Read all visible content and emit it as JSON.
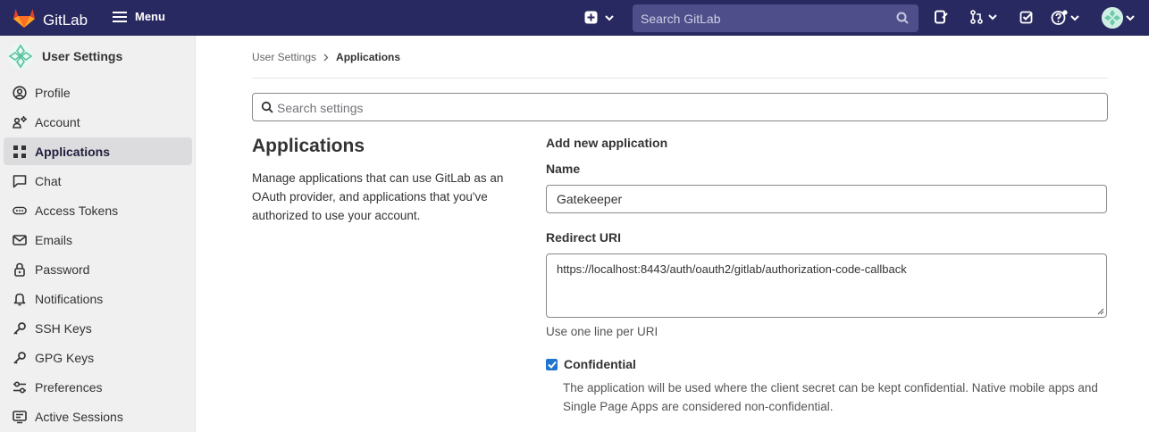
{
  "navbar": {
    "brand": "GitLab",
    "menu_label": "Menu",
    "search_placeholder": "Search GitLab",
    "icons": [
      "plus-square-icon",
      "chevron-down-icon",
      "search-icon",
      "issues-icon",
      "merge-request-icon",
      "todo-icon",
      "help-icon",
      "avatar"
    ]
  },
  "sidebar": {
    "context_title": "User Settings",
    "items": [
      {
        "label": "Profile",
        "icon": "profile-icon",
        "active": false
      },
      {
        "label": "Account",
        "icon": "account-icon",
        "active": false
      },
      {
        "label": "Applications",
        "icon": "applications-icon",
        "active": true
      },
      {
        "label": "Chat",
        "icon": "comment-icon",
        "active": false
      },
      {
        "label": "Access Tokens",
        "icon": "token-icon",
        "active": false
      },
      {
        "label": "Emails",
        "icon": "mail-icon",
        "active": false
      },
      {
        "label": "Password",
        "icon": "lock-icon",
        "active": false
      },
      {
        "label": "Notifications",
        "icon": "notifications-icon",
        "active": false
      },
      {
        "label": "SSH Keys",
        "icon": "key-icon",
        "active": false
      },
      {
        "label": "GPG Keys",
        "icon": "key-icon",
        "active": false
      },
      {
        "label": "Preferences",
        "icon": "preferences-icon",
        "active": false
      },
      {
        "label": "Active Sessions",
        "icon": "monitor-lines-icon",
        "active": false
      }
    ]
  },
  "breadcrumb": {
    "parent": "User Settings",
    "current": "Applications"
  },
  "settings_search": {
    "placeholder": "Search settings"
  },
  "section": {
    "title": "Applications",
    "description": "Manage applications that can use GitLab as an OAuth provider, and applications that you've authorized to use your account."
  },
  "form": {
    "heading": "Add new application",
    "name_label": "Name",
    "name_value": "Gatekeeper",
    "redirect_label": "Redirect URI",
    "redirect_value": "https://localhost:8443/auth/oauth2/gitlab/authorization-code-callback",
    "redirect_help": "Use one line per URI",
    "confidential_label": "Confidential",
    "confidential_checked": true,
    "confidential_help": "The application will be used where the client secret can be kept confidential. Native mobile apps and Single Page Apps are considered non-confidential."
  },
  "colors": {
    "navbar": "#292961",
    "sidebar": "#f0f0f0",
    "active_item": "#dcdcde",
    "checkbox": "#1f75cb",
    "brand_orange": "#fc6d26"
  }
}
